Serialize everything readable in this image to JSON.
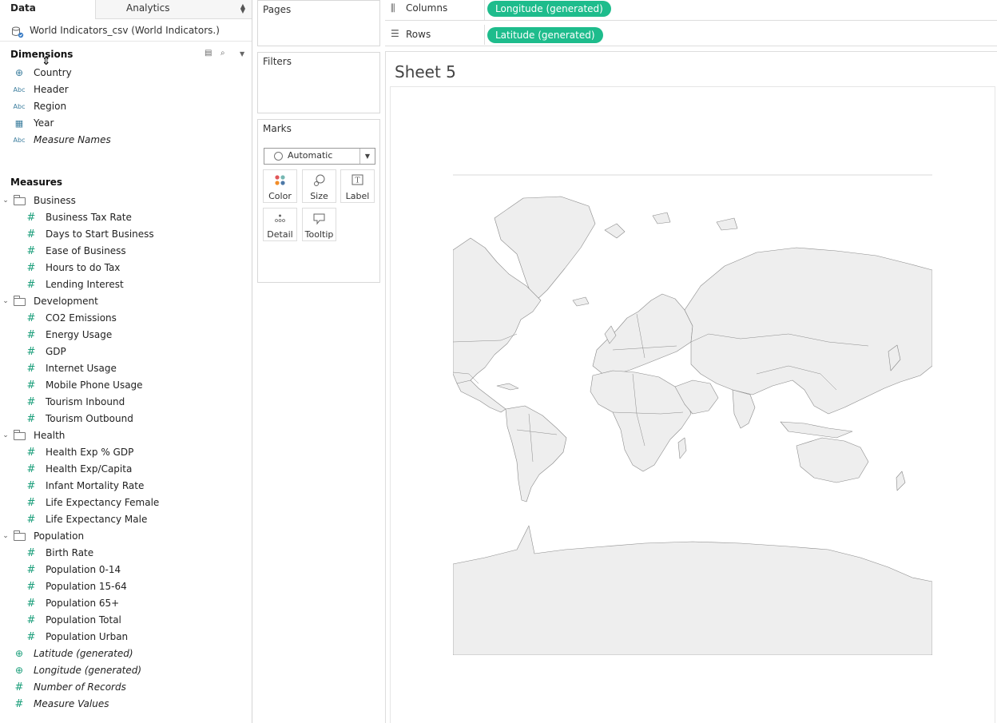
{
  "data_pane": {
    "tab_data": "Data",
    "tab_analytics": "Analytics",
    "datasource": "World Indicators_csv (World Indicators.)",
    "dimensions_title": "Dimensions",
    "measures_title": "Measures",
    "dimensions": [
      {
        "label": "Country",
        "icon": "globe-icon",
        "italic": false
      },
      {
        "label": "Header",
        "icon": "abc-icon",
        "italic": false
      },
      {
        "label": "Region",
        "icon": "abc-icon",
        "italic": false
      },
      {
        "label": "Year",
        "icon": "calendar-icon",
        "italic": false
      },
      {
        "label": "Measure Names",
        "icon": "abc-icon",
        "italic": true
      }
    ],
    "folders": [
      {
        "name": "Business",
        "items": [
          "Business Tax Rate",
          "Days to Start Business",
          "Ease of Business",
          "Hours to do Tax",
          "Lending Interest"
        ]
      },
      {
        "name": "Development",
        "items": [
          "CO2 Emissions",
          "Energy Usage",
          "GDP",
          "Internet Usage",
          "Mobile Phone Usage",
          "Tourism Inbound",
          "Tourism Outbound"
        ]
      },
      {
        "name": "Health",
        "items": [
          "Health Exp % GDP",
          "Health Exp/Capita",
          "Infant Mortality Rate",
          "Life Expectancy Female",
          "Life Expectancy Male"
        ]
      },
      {
        "name": "Population",
        "items": [
          "Birth Rate",
          "Population 0-14",
          "Population 15-64",
          "Population 65+",
          "Population Total",
          "Population Urban"
        ]
      }
    ],
    "generated": [
      {
        "label": "Latitude (generated)",
        "icon": "globe-icon"
      },
      {
        "label": "Longitude (generated)",
        "icon": "globe-icon"
      },
      {
        "label": "Number of Records",
        "icon": "hash-icon"
      },
      {
        "label": "Measure Values",
        "icon": "hash-icon"
      }
    ]
  },
  "cards": {
    "pages": "Pages",
    "filters": "Filters",
    "marks": "Marks",
    "mark_type": "Automatic",
    "mark_buttons": [
      "Color",
      "Size",
      "Label",
      "Detail",
      "Tooltip"
    ]
  },
  "shelves": {
    "columns_label": "Columns",
    "columns_pill": "Longitude (generated)",
    "rows_label": "Rows",
    "rows_pill": "Latitude (generated)"
  },
  "view": {
    "sheet_title": "Sheet 5"
  },
  "colors": {
    "pill": "#1ebc8c",
    "land": "#eeeeee",
    "borders": "#8a8a8a",
    "measure_icon": "#1a9e7a",
    "dimension_icon": "#3b7d9d"
  }
}
